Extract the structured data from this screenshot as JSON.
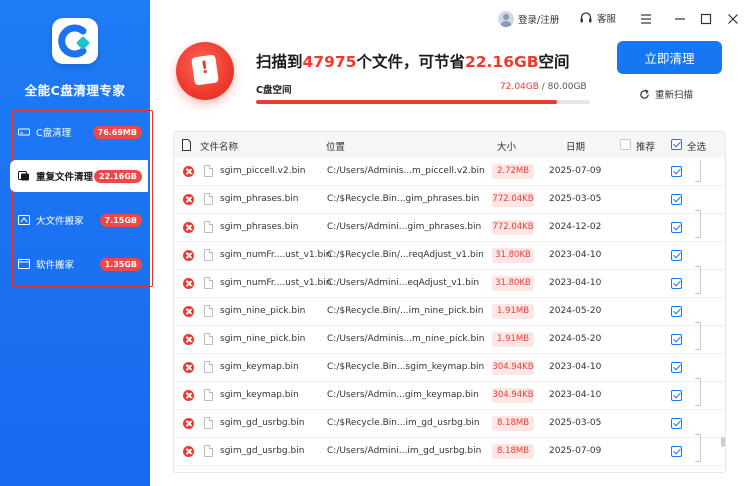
{
  "app": {
    "name": "全能C盘清理专家",
    "brand_color": "#1677f2",
    "accent_red": "#ee3a2e"
  },
  "topbar": {
    "login_label": "登录/注册",
    "service_label": "客服",
    "icons": [
      "avatar",
      "headset-icon",
      "menu-icon",
      "minimize-icon",
      "maximize-icon",
      "close-icon"
    ]
  },
  "sidebar": {
    "items": [
      {
        "label": "C盘清理",
        "badge": "76.69MB",
        "icon": "drive-icon",
        "active": false
      },
      {
        "label": "重复文件清理",
        "badge": "22.16GB",
        "icon": "duplicate-file-icon",
        "active": true
      },
      {
        "label": "大文件搬家",
        "badge": "7.15GB",
        "icon": "large-file-icon",
        "active": false
      },
      {
        "label": "软件搬家",
        "badge": "1.35GB",
        "icon": "software-move-icon",
        "active": false
      }
    ]
  },
  "scan": {
    "prefix": "扫描到",
    "count": "47975",
    "middle": "个文件，可节省",
    "saving": "22.16GB",
    "suffix": "空间",
    "space_label": "C盘空间",
    "used": "72.04GB",
    "total_text": " / 80.00GB",
    "used_fraction": 0.9,
    "clean_button": "立即清理",
    "rescan_label": "重新扫描"
  },
  "table": {
    "headers": {
      "name": "文件名称",
      "path": "位置",
      "size": "大小",
      "date": "日期",
      "recommend": "推荐",
      "select_all": "全选"
    },
    "rows": [
      {
        "name": "sgim_piccell.v2.bin",
        "path": "C:/Users/Adminis...m_piccell.v2.bin",
        "size": "2.72MB",
        "date": "2025-07-09",
        "checked": true
      },
      {
        "name": "sgim_phrases.bin",
        "path": "C:/$Recycle.Bin...gim_phrases.bin",
        "size": "772.04KB",
        "date": "2025-03-05",
        "checked": true
      },
      {
        "name": "sgim_phrases.bin",
        "path": "C:/Users/Admini...gim_phrases.bin",
        "size": "772.04KB",
        "date": "2024-12-02",
        "checked": true
      },
      {
        "name": "sgim_numFr....ust_v1.bin",
        "path": "C:/$Recycle.Bin/...reqAdjust_v1.bin",
        "size": "31.80KB",
        "date": "2023-04-10",
        "checked": true
      },
      {
        "name": "sgim_numFr....ust_v1.bin",
        "path": "C:/Users/Admini...eqAdjust_v1.bin",
        "size": "31.80KB",
        "date": "2023-04-10",
        "checked": true
      },
      {
        "name": "sgim_nine_pick.bin",
        "path": "C:/$Recycle.Bin/...im_nine_pick.bin",
        "size": "1.91MB",
        "date": "2024-05-20",
        "checked": true
      },
      {
        "name": "sgim_nine_pick.bin",
        "path": "C:/Users/Adminis...m_nine_pick.bin",
        "size": "1.91MB",
        "date": "2024-05-20",
        "checked": true
      },
      {
        "name": "sgim_keymap.bin",
        "path": "C:/$Recycle.Bin...sgim_keymap.bin",
        "size": "304.94KB",
        "date": "2023-04-10",
        "checked": true
      },
      {
        "name": "sgim_keymap.bin",
        "path": "C:/Users/Admin...gim_keymap.bin",
        "size": "304.94KB",
        "date": "2023-04-10",
        "checked": true
      },
      {
        "name": "sgim_gd_usrbg.bin",
        "path": "C:/$Recycle.Bin...im_gd_usrbg.bin",
        "size": "8.18MB",
        "date": "2025-03-05",
        "checked": true
      },
      {
        "name": "sgim_gd_usrbg.bin",
        "path": "C:/Users/Admini...im_gd_usrbg.bin",
        "size": "8.18MB",
        "date": "2025-07-09",
        "checked": true
      }
    ]
  }
}
